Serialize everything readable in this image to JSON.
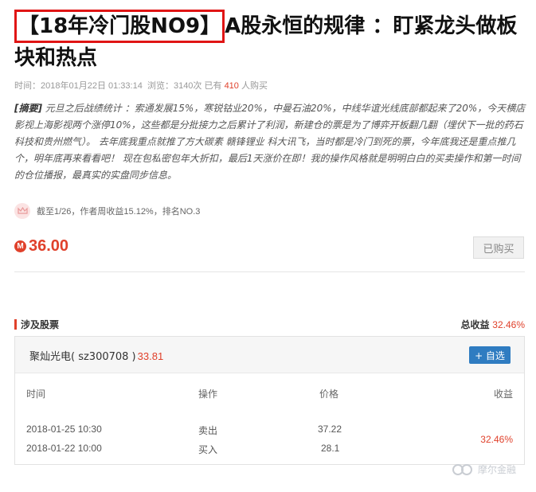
{
  "article": {
    "title_boxed": "【18年冷门股NO9】",
    "title_rest": "A股永恒的规律 ：盯紧龙头做板块和热点",
    "meta": {
      "time_label": "时间：",
      "time": "2018年01月22日 01:33:14",
      "views_label": "浏览：",
      "views": "3140次",
      "buyers_prefix": "已有",
      "buyers_count": "410",
      "buyers_suffix": "人购买"
    },
    "summary_tag": "[摘要]",
    "summary_text": " 元旦之后战绩统计 ：索通发展15%，寒锐钴业20%，中曼石油20%，中线华谊光线底部都起来了20%，今天横店影视上海影视两个涨停10%，这些都是分批接力之后累计了利润，新建仓的票是为了博弈开板翻几翻（埋伏下一批的药石科技和贵州燃气）。 去年底我重点就推了方大碳素 赣锋锂业 科大讯飞，当时都是冷门到死的票，今年底我还是重点推几个，明年底再来看看吧！ 现在包私密包年大折扣，最后1天涨价在即！我的操作风格就是明明白白的买卖操作和第一时间的仓位播报，最真实的实盘同步信息。",
    "rank_text": "截至1/26，作者周收益15.12%，排名NO.3",
    "price": "36.00",
    "coin_symbol": "M",
    "bought_label": "已购买"
  },
  "stocks_section": {
    "title": "涉及股票",
    "total_return_label": "总收益",
    "total_return_value": "32.46%",
    "stock": {
      "name": "聚灿光电( sz300708 )",
      "price": "33.81",
      "watch_label": "+ 自选",
      "columns": [
        "时间",
        "操作",
        "价格",
        "收益"
      ],
      "trades": [
        {
          "time": "2018-01-25 10:30",
          "action": "卖出",
          "price": "37.22"
        },
        {
          "time": "2018-01-22 10:00",
          "action": "买入",
          "price": "28.1"
        }
      ],
      "return": "32.46%"
    }
  },
  "watermark": "摩尔金融",
  "colors": {
    "accent": "#e0412b",
    "title_box": "#e01515",
    "button_blue": "#2f7cc1"
  }
}
